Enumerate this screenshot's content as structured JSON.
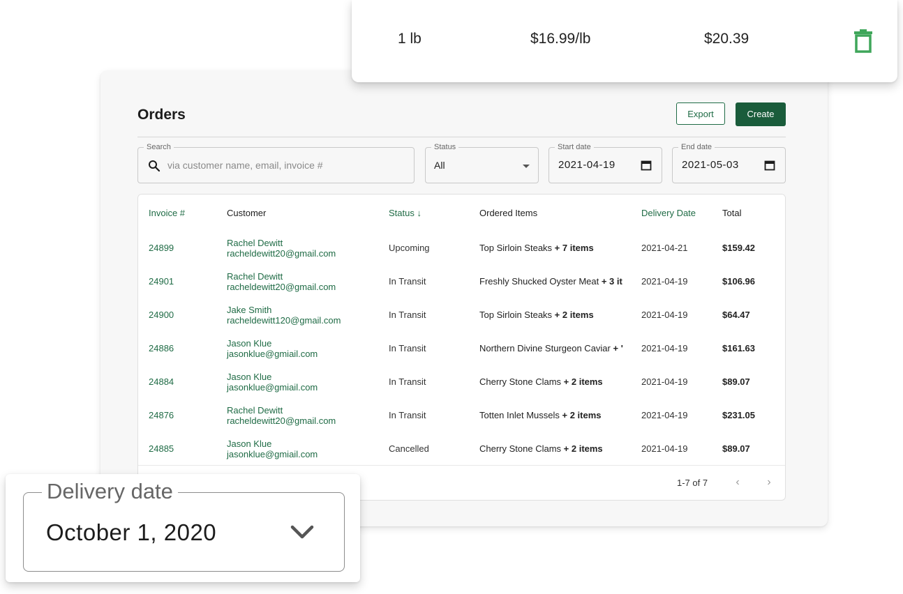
{
  "cart_line": {
    "quantity": "1 lb",
    "unit_price": "$16.99/lb",
    "line_total": "$20.39",
    "icon": "trash-icon",
    "icon_color": "#3fa65a"
  },
  "orders": {
    "title": "Orders",
    "export_label": "Export",
    "create_label": "Create",
    "accent_color": "#1f6b45",
    "filters": {
      "search_legend": "Search",
      "search_placeholder": "via customer name, email, invoice #",
      "status_legend": "Status",
      "status_value": "All",
      "start_legend": "Start date",
      "start_value": "2021-04-19",
      "end_legend": "End date",
      "end_value": "2021-05-03"
    },
    "columns": {
      "invoice": "Invoice #",
      "customer": "Customer",
      "status": "Status ↓",
      "items": "Ordered Items",
      "delivery": "Delivery Date",
      "total": "Total"
    },
    "rows": [
      {
        "invoice": "24899",
        "name": "Rachel Dewitt",
        "email": "racheldewitt20@gmail.com",
        "status": "Upcoming",
        "item": "Top Sirloin Steaks",
        "extra": " + 7 items",
        "date": "2021-04-21",
        "total": "$159.42"
      },
      {
        "invoice": "24901",
        "name": "Rachel Dewitt",
        "email": "racheldewitt20@gmail.com",
        "status": "In Transit",
        "item": "Freshly Shucked Oyster Meat",
        "extra": " + 3 it",
        "date": "2021-04-19",
        "total": "$106.96"
      },
      {
        "invoice": "24900",
        "name": "Jake Smith",
        "email": "racheldewitt120@gmail.com",
        "status": "In Transit",
        "item": "Top Sirloin Steaks",
        "extra": " + 2 items",
        "date": "2021-04-19",
        "total": "$64.47"
      },
      {
        "invoice": "24886",
        "name": "Jason Klue",
        "email": "jasonklue@gmiail.com",
        "status": "In Transit",
        "item": "Northern Divine Sturgeon Caviar",
        "extra": " + '",
        "date": "2021-04-19",
        "total": "$161.63"
      },
      {
        "invoice": "24884",
        "name": "Jason Klue",
        "email": "jasonklue@gmiail.com",
        "status": "In Transit",
        "item": "Cherry Stone Clams",
        "extra": " + 2 items",
        "date": "2021-04-19",
        "total": "$89.07"
      },
      {
        "invoice": "24876",
        "name": "Rachel Dewitt",
        "email": "racheldewitt20@gmail.com",
        "status": "In Transit",
        "item": "Totten Inlet Mussels",
        "extra": " + 2 items",
        "date": "2021-04-19",
        "total": "$231.05"
      },
      {
        "invoice": "24885",
        "name": "Jason Klue",
        "email": "jasonklue@gmiail.com",
        "status": "Cancelled",
        "item": "Cherry Stone Clams",
        "extra": " + 2 items",
        "date": "2021-04-19",
        "total": "$89.07"
      }
    ],
    "pagination": {
      "range": "1-7 of 7",
      "prev": "‹",
      "next": "›"
    }
  },
  "delivery_picker": {
    "legend": "Delivery date",
    "value": "October 1, 2020",
    "icon": "chevron-down-icon"
  }
}
